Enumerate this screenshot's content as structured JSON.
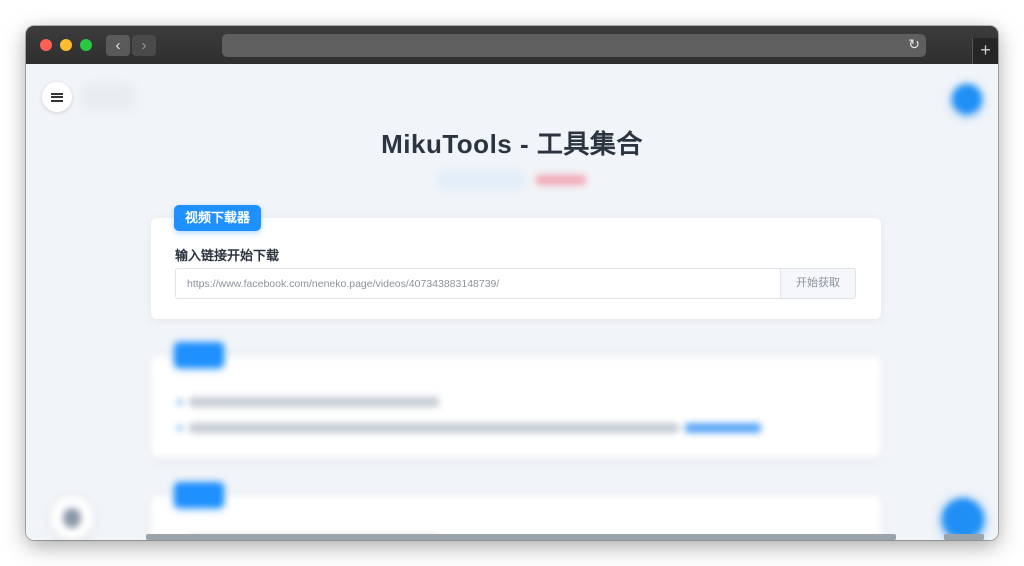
{
  "browser": {
    "back_icon": "chevron-left-icon",
    "forward_icon": "chevron-right-icon",
    "reload_icon": "reload-icon",
    "newtab_icon": "plus-icon",
    "url": ""
  },
  "page": {
    "title": "MikuTools - 工具集合",
    "menu_icon": "menu-icon"
  },
  "downloader": {
    "badge": "视频下载器",
    "heading": "输入链接开始下载",
    "input_value": "https://www.facebook.com/neneko.page/videos/407343883148739/",
    "fetch_button": "开始获取"
  },
  "colors": {
    "accent": "#1e90ff",
    "background": "#f1f4f8",
    "title": "#2b3440"
  }
}
